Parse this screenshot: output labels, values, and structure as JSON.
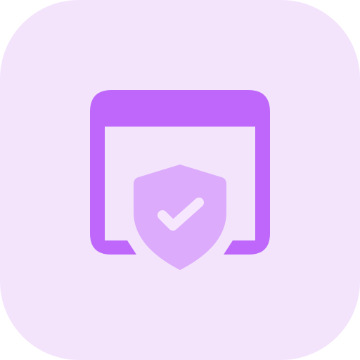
{
  "icon": {
    "name": "browser-security-icon",
    "parts": [
      "browser-window-icon",
      "shield-check-icon"
    ]
  },
  "colors": {
    "tile_background": "#f3e4fc",
    "window_frame": "#be67fa",
    "shield": "#dcabfb",
    "checkmark": "#f6e7fe"
  }
}
